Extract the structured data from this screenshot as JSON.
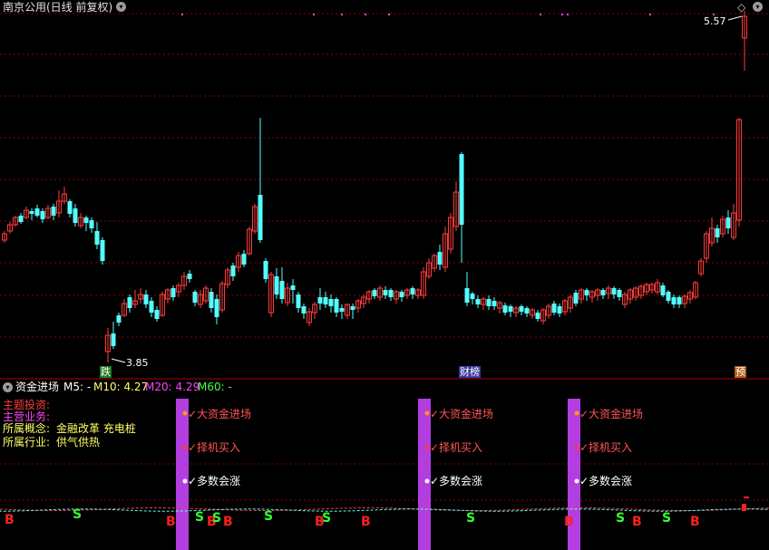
{
  "header": {
    "stock_title": "南京公用(日线 前复权)",
    "max_price_label": "5.57",
    "min_price_label": "3.85"
  },
  "markers": {
    "drop": "跌",
    "finance": "财榜",
    "pre": "预"
  },
  "indicator": {
    "name": "资金进场",
    "ma5": "M5: -",
    "ma10": "M10: 4.27",
    "ma20": "M20: 4.29",
    "ma60": "M60: -"
  },
  "info": {
    "theme": "主题投资:",
    "business": "主营业务:",
    "concept_label": "所属概念:",
    "concept_value": "金融改革 充电桩",
    "industry_label": "所属行业:",
    "industry_value": "供气供热"
  },
  "signals": {
    "big_capital": "✓大资金进场",
    "select_buy": "✓择机买入",
    "majority_up": "✓多数会涨"
  },
  "colors": {
    "up": "#ff3b3b",
    "down": "#54ffff",
    "grid": "#8a0000",
    "purple_bar": "#b23ee0",
    "signal_text": "#ff5555",
    "info_yellow": "#ffff66",
    "info_magenta": "#ff44ff"
  },
  "bs_marks": [
    "B",
    "S",
    "B",
    "S",
    "B",
    "S",
    "B",
    "S",
    "B",
    "S",
    "B",
    "S",
    "B",
    "S",
    "B",
    "S",
    "B"
  ],
  "chart_data": {
    "type": "candlestick",
    "max_price": 5.57,
    "min_price": 3.85
  }
}
